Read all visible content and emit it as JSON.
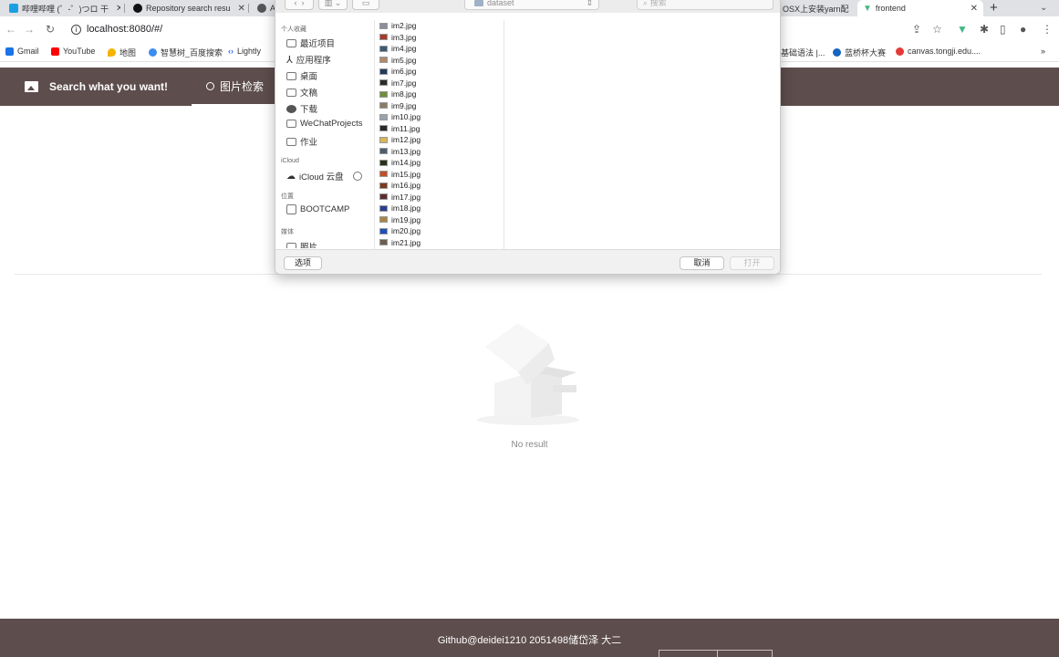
{
  "browser": {
    "tabs": [
      {
        "title": "哔哩哔哩 (゜-゜)つロ 干",
        "color": "#1aa0e2",
        "active": false
      },
      {
        "title": "Repository search resu",
        "color": "#111111",
        "active": false
      },
      {
        "title": "A",
        "color": "#555555",
        "active": false
      },
      {
        "title": "OSX上安装yarn配",
        "color": "#ffffff",
        "active": false
      },
      {
        "title": "frontend",
        "color": "#41b883",
        "active": true
      }
    ],
    "new_tab": "+",
    "url": "localhost:8080/#/",
    "bookmarks_left": [
      {
        "label": "Gmail",
        "color": "#1a73e8"
      },
      {
        "label": "YouTube",
        "color": "#ff0000"
      },
      {
        "label": "地图",
        "color": "#f4b400"
      },
      {
        "label": "智慧树_百度搜索",
        "color": "#3b8cf3"
      },
      {
        "label": "Lightly",
        "color": "#2f6bf0"
      }
    ],
    "bookmarks_right": [
      {
        "label": "基础语法 |...",
        "color": "#ffffff"
      },
      {
        "label": "蓝桥杯大赛",
        "color": "#1565c0"
      },
      {
        "label": "canvas.tongji.edu....",
        "color": "#e53935"
      }
    ],
    "bookmarks_more": "»"
  },
  "app": {
    "brand_title": "Search what you want!",
    "menu_tab": "图片检索",
    "empty_text": "No result",
    "footer_text": "Github@deidei1210 2051498储岱泽 大二",
    "header_color": "#5d4d4c"
  },
  "dialog": {
    "folder": "dataset",
    "search_placeholder": "搜索",
    "sidebar": {
      "favorites_heading": "个人收藏",
      "favorites": [
        "最近项目",
        "应用程序",
        "桌面",
        "文稿",
        "下载",
        "WeChatProjects",
        "作业"
      ],
      "icloud_heading": "iCloud",
      "icloud": [
        "iCloud 云盘"
      ],
      "locations_heading": "位置",
      "locations": [
        "BOOTCAMP"
      ],
      "media_heading": "媒体",
      "media": [
        "照片"
      ]
    },
    "files": [
      "im2.jpg",
      "im3.jpg",
      "im4.jpg",
      "im5.jpg",
      "im6.jpg",
      "im7.jpg",
      "im8.jpg",
      "im9.jpg",
      "im10.jpg",
      "im11.jpg",
      "im12.jpg",
      "im13.jpg",
      "im14.jpg",
      "im15.jpg",
      "im16.jpg",
      "im17.jpg",
      "im18.jpg",
      "im19.jpg",
      "im20.jpg",
      "im21.jpg"
    ],
    "options_button": "选项",
    "cancel_button": "取消",
    "open_button": "打开"
  }
}
